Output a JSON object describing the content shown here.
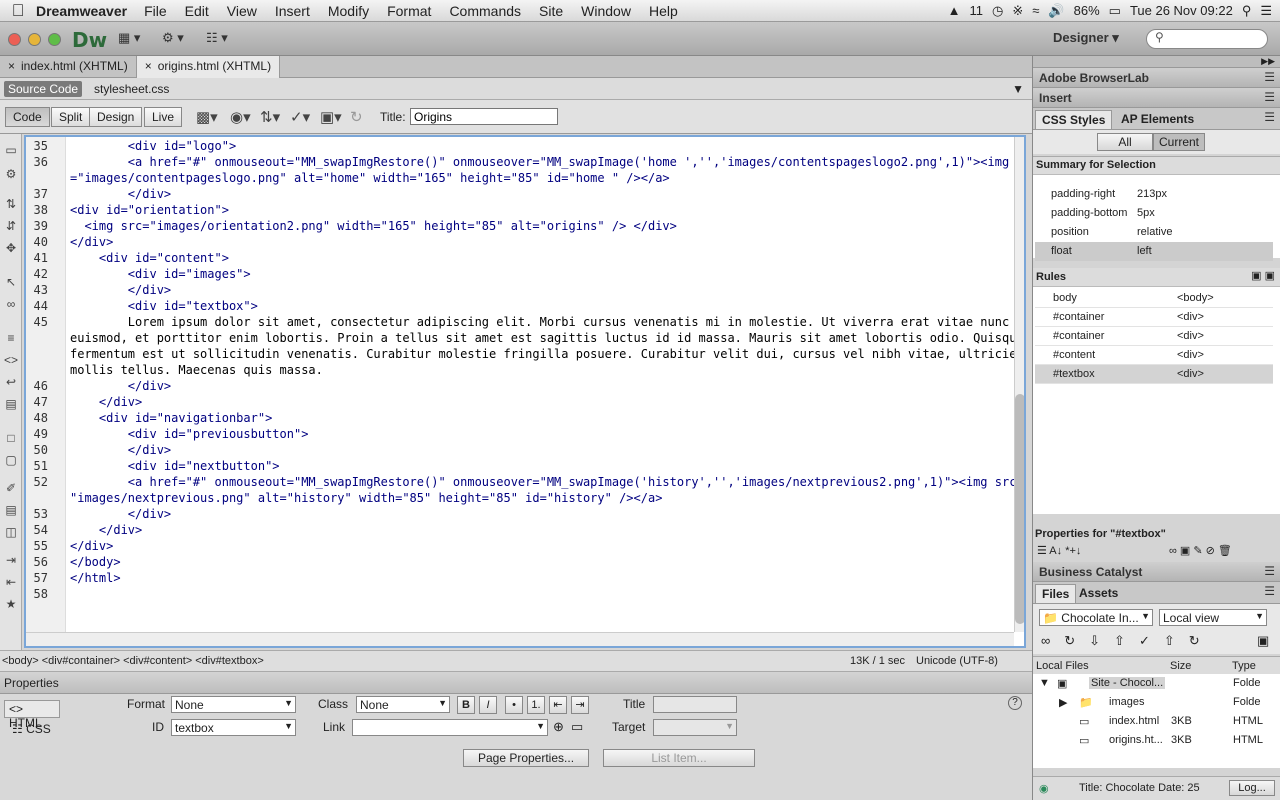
{
  "menubar": {
    "app": "Dreamweaver",
    "items": [
      "File",
      "Edit",
      "View",
      "Insert",
      "Modify",
      "Format",
      "Commands",
      "Site",
      "Window",
      "Help"
    ],
    "adobe_count": "11",
    "battery": "86%",
    "clock": "Tue 26 Nov  09:22"
  },
  "titlebar": {
    "logo": "Dw",
    "workspace": "Designer"
  },
  "doc_tabs": [
    {
      "label": "index.html (XHTML)"
    },
    {
      "label": "origins.html (XHTML)"
    }
  ],
  "related_files": {
    "source": "Source Code",
    "css": "stylesheet.css"
  },
  "toolbar": {
    "code": "Code",
    "split": "Split",
    "design": "Design",
    "live": "Live",
    "title_label": "Title:",
    "title_value": "Origins"
  },
  "code_lines": [
    {
      "n": "35",
      "text": "        <div id=\"logo\">"
    },
    {
      "n": "36",
      "text": "        <a href=\"#\" onmouseout=\"MM_swapImgRestore()\" onmouseover=\"MM_swapImage('home ','','images/contentspageslogo2.png',1)\"><img src"
    },
    {
      "n": "",
      "text": "=\"images/contentpageslogo.png\" alt=\"home\" width=\"165\" height=\"85\" id=\"home \" /></a>"
    },
    {
      "n": "37",
      "text": "        </div>"
    },
    {
      "n": "38",
      "text": "<div id=\"orientation\">"
    },
    {
      "n": "39",
      "text": "  <img src=\"images/orientation2.png\" width=\"165\" height=\"85\" alt=\"origins\" /> </div>"
    },
    {
      "n": "40",
      "text": "</div>"
    },
    {
      "n": "41",
      "text": "    <div id=\"content\">"
    },
    {
      "n": "42",
      "text": "        <div id=\"images\">"
    },
    {
      "n": "43",
      "text": "        </div>"
    },
    {
      "n": "44",
      "text": "        <div id=\"textbox\">"
    },
    {
      "n": "45",
      "text": "        Lorem ipsum dolor sit amet, consectetur adipiscing elit. Morbi cursus venenatis mi in molestie. Ut viverra erat vitae nunc"
    },
    {
      "n": "",
      "text": "euismod, et porttitor enim lobortis. Proin a tellus sit amet est sagittis luctus id id massa. Mauris sit amet lobortis odio. Quisque"
    },
    {
      "n": "",
      "text": "fermentum est ut sollicitudin venenatis. Curabitur molestie fringilla posuere. Curabitur velit dui, cursus vel nibh vitae, ultricies"
    },
    {
      "n": "",
      "text": "mollis tellus. Maecenas quis massa."
    },
    {
      "n": "46",
      "text": "        </div>"
    },
    {
      "n": "47",
      "text": "    </div>"
    },
    {
      "n": "48",
      "text": "    <div id=\"navigationbar\">"
    },
    {
      "n": "49",
      "text": "        <div id=\"previousbutton\">"
    },
    {
      "n": "50",
      "text": "        </div>"
    },
    {
      "n": "51",
      "text": "        <div id=\"nextbutton\">"
    },
    {
      "n": "52",
      "text": "        <a href=\"#\" onmouseout=\"MM_swapImgRestore()\" onmouseover=\"MM_swapImage('history','','images/nextprevious2.png',1)\"><img src="
    },
    {
      "n": "",
      "text": "\"images/nextprevious.png\" alt=\"history\" width=\"85\" height=\"85\" id=\"history\" /></a>"
    },
    {
      "n": "53",
      "text": "        </div>"
    },
    {
      "n": "54",
      "text": "    </div>"
    },
    {
      "n": "55",
      "text": "</div>"
    },
    {
      "n": "56",
      "text": "</body>"
    },
    {
      "n": "57",
      "text": "</html>"
    },
    {
      "n": "58",
      "text": ""
    }
  ],
  "status": {
    "tag_selector": "<body> <div#container> <div#content> <div#textbox>",
    "size": "13K / 1 sec",
    "encoding": "Unicode (UTF-8)"
  },
  "properties": {
    "header": "Properties",
    "html_tab": "HTML",
    "css_tab": "CSS",
    "format_label": "Format",
    "format_value": "None",
    "class_label": "Class",
    "class_value": "None",
    "id_label": "ID",
    "id_value": "textbox",
    "link_label": "Link",
    "title_label": "Title",
    "target_label": "Target",
    "bold": "B",
    "italic": "I",
    "page_properties": "Page Properties...",
    "list_item": "List Item..."
  },
  "right_panel": {
    "browserlab": "Adobe BrowserLab",
    "insert": "Insert",
    "css_styles": "CSS Styles",
    "ap_elements": "AP Elements",
    "all": "All",
    "current": "Current",
    "summary_title": "Summary for Selection",
    "summary": [
      {
        "k": "padding-right",
        "v": "213px"
      },
      {
        "k": "padding-bottom",
        "v": "5px"
      },
      {
        "k": "position",
        "v": "relative"
      },
      {
        "k": "float",
        "v": "left"
      }
    ],
    "rules_title": "Rules",
    "rules": [
      {
        "k": "body",
        "v": "<body>"
      },
      {
        "k": "#container",
        "v": "<div>"
      },
      {
        "k": "#container",
        "v": "<div>"
      },
      {
        "k": "#content",
        "v": "<div>"
      },
      {
        "k": "#textbox",
        "v": "<div>"
      }
    ],
    "properties_for": "Properties for \"#textbox\"",
    "business_catalyst": "Business Catalyst",
    "files": "Files",
    "assets": "Assets",
    "site_select": "Chocolate In...",
    "view_select": "Local view",
    "file_cols": {
      "name": "Local Files",
      "size": "Size",
      "type": "Type"
    },
    "file_rows": [
      {
        "name": "Site - Chocol...",
        "size": "",
        "type": "Folde"
      },
      {
        "name": "images",
        "size": "",
        "type": "Folde"
      },
      {
        "name": "index.html",
        "size": "3KB",
        "type": "HTML"
      },
      {
        "name": "origins.ht...",
        "size": "3KB",
        "type": "HTML"
      }
    ],
    "footer_title": "Title: Chocolate  Date: 25",
    "log_button": "Log..."
  }
}
